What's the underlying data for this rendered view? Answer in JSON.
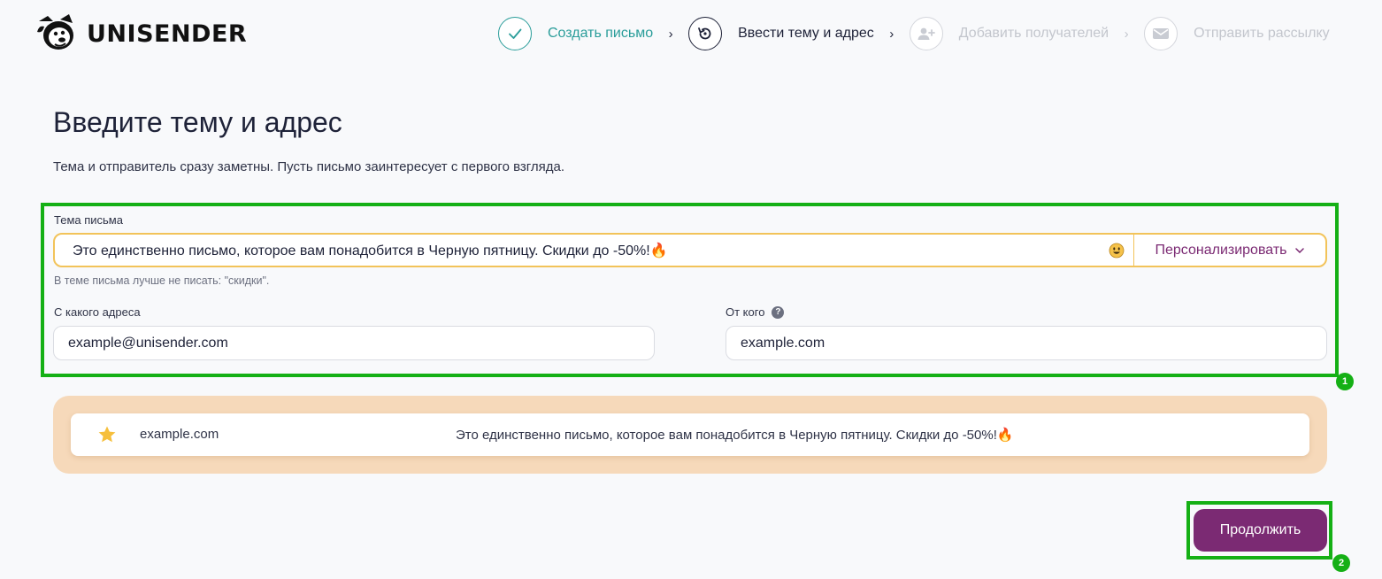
{
  "brand": {
    "name": "UNISENDER",
    "accent": "#7b2a73",
    "teal": "#2a9d9a",
    "highlight": "#15b015"
  },
  "steps": [
    {
      "label": "Создать письмо",
      "state": "done",
      "icon": "check-icon"
    },
    {
      "label": "Ввести тему и адрес",
      "state": "active",
      "icon": "refresh-icon"
    },
    {
      "label": "Добавить получателей",
      "state": "todo",
      "icon": "add-user-icon"
    },
    {
      "label": "Отправить рассылку",
      "state": "todo",
      "icon": "envelope-icon"
    }
  ],
  "page": {
    "title": "Введите тему и адрес",
    "subtitle": "Тема и отправитель сразу заметны. Пусть письмо заинтересует с первого взгляда."
  },
  "form": {
    "subject_label": "Тема письма",
    "subject_value": "Это единственно письмо, которое вам понадобится в Черную пятницу. Скидки до -50%!🔥",
    "personalize_label": "Персонализировать",
    "hint": "В теме письма лучше не писать: \"скидки\".",
    "from_email_label": "С какого адреса",
    "from_email_value": "example@unisender.com",
    "from_name_label": "От кого",
    "from_name_value": "example.com"
  },
  "preview": {
    "sender": "example.com",
    "subject": "Это единственно письмо, которое вам понадобится в Черную пятницу. Скидки до -50%!🔥"
  },
  "actions": {
    "continue_label": "Продолжить"
  },
  "annotations": {
    "marker_1": "1",
    "marker_2": "2"
  }
}
